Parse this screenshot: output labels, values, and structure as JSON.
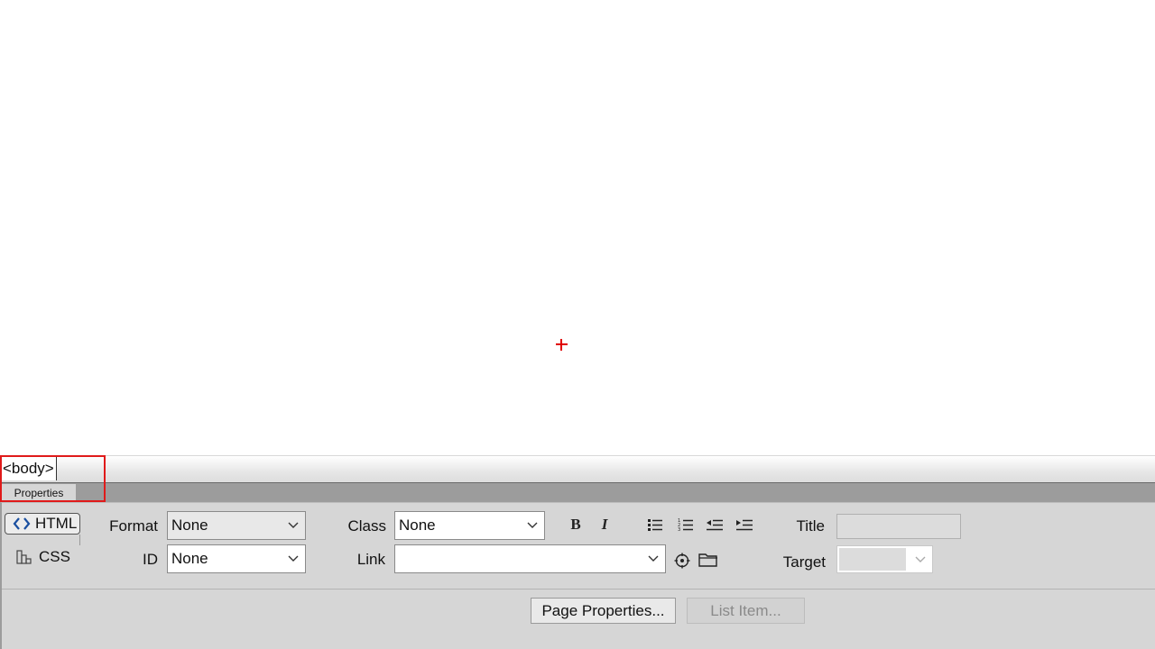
{
  "tag_selector": {
    "tag": "<body>"
  },
  "panel": {
    "tab_label": "Properties"
  },
  "mode": {
    "html_label": "HTML",
    "css_label": "CSS"
  },
  "fields": {
    "format_label": "Format",
    "format_value": "None",
    "id_label": "ID",
    "id_value": "None",
    "class_label": "Class",
    "class_value": "None",
    "link_label": "Link",
    "link_value": "",
    "title_label": "Title",
    "title_value": "",
    "target_label": "Target",
    "target_value": ""
  },
  "toolbar": {
    "bold_icon": "bold-icon",
    "italic_icon": "italic-icon",
    "unordered_list_icon": "unordered-list-icon",
    "ordered_list_icon": "ordered-list-icon",
    "outdent_icon": "outdent-icon",
    "indent_icon": "indent-icon",
    "point_to_file_icon": "point-to-file-icon",
    "browse_folder_icon": "folder-icon"
  },
  "buttons": {
    "page_properties": "Page Properties...",
    "list_item": "List Item..."
  },
  "colors": {
    "highlight": "#e01a1a",
    "cursor": "#e00000",
    "panel_bg": "#d6d6d6"
  }
}
